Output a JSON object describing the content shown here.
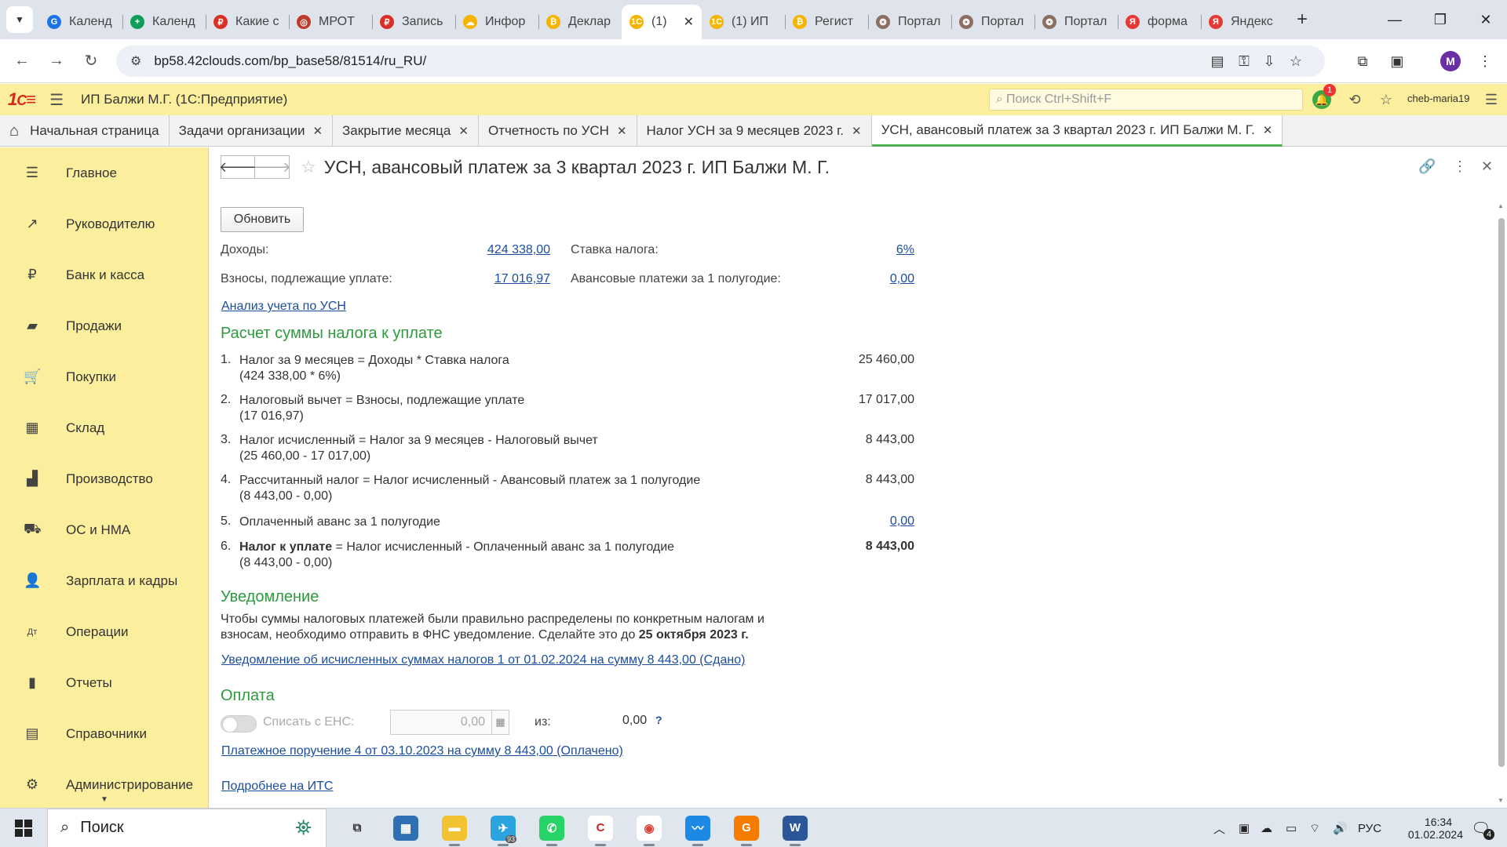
{
  "browser": {
    "tabs": [
      {
        "title": "Календ",
        "color": "#1a73e8",
        "glyph": "G"
      },
      {
        "title": "Календ",
        "color": "#0f9d58",
        "glyph": "+"
      },
      {
        "title": "Какие с",
        "color": "#d93025",
        "glyph": "₽"
      },
      {
        "title": "МРОТ",
        "color": "#c0392b",
        "glyph": "◎"
      },
      {
        "title": "Запись",
        "color": "#d93025",
        "glyph": "₽"
      },
      {
        "title": "Инфор",
        "color": "#f4b400",
        "glyph": "☁"
      },
      {
        "title": "Деклар",
        "color": "#f4b400",
        "glyph": "₿"
      },
      {
        "title": "(1)",
        "color": "#f4b400",
        "glyph": "1С",
        "active": true
      },
      {
        "title": "(1) ИП",
        "color": "#f4b400",
        "glyph": "1С"
      },
      {
        "title": "Регист",
        "color": "#f4b400",
        "glyph": "₿"
      },
      {
        "title": "Портал",
        "color": "#8d6e63",
        "glyph": "❂"
      },
      {
        "title": "Портал",
        "color": "#8d6e63",
        "glyph": "❂"
      },
      {
        "title": "Портал",
        "color": "#8d6e63",
        "glyph": "❂"
      },
      {
        "title": "форма",
        "color": "#e53935",
        "glyph": "Я"
      },
      {
        "title": "Яндекс",
        "color": "#e53935",
        "glyph": "Я"
      }
    ],
    "url": "bp58.42clouds.com/bp_base58/81514/ru_RU/",
    "profile_initial": "M"
  },
  "app": {
    "title": "ИП Балжи М.Г.  (1С:Предприятие)",
    "search_placeholder": "Поиск Ctrl+Shift+F",
    "notification_count": "1",
    "user": "cheb-maria19"
  },
  "section_tabs": [
    {
      "label": "Начальная страница",
      "closable": false
    },
    {
      "label": "Задачи организации",
      "closable": true
    },
    {
      "label": "Закрытие месяца",
      "closable": true
    },
    {
      "label": "Отчетность по УСН",
      "closable": true
    },
    {
      "label": "Налог УСН за 9 месяцев 2023 г.",
      "closable": true
    },
    {
      "label": "УСН, авансовый платеж за 3 квартал 2023 г. ИП Балжи М. Г.",
      "closable": true,
      "active": true
    }
  ],
  "sidebar": [
    {
      "label": "Главное",
      "icon": "menu-icon",
      "glyph": "☰"
    },
    {
      "label": "Руководителю",
      "icon": "trend-icon",
      "glyph": "↗"
    },
    {
      "label": "Банк и касса",
      "icon": "coin-icon",
      "glyph": "₽"
    },
    {
      "label": "Продажи",
      "icon": "bag-icon",
      "glyph": "▰"
    },
    {
      "label": "Покупки",
      "icon": "cart-icon",
      "glyph": "🛒"
    },
    {
      "label": "Склад",
      "icon": "warehouse-icon",
      "glyph": "▦"
    },
    {
      "label": "Производство",
      "icon": "factory-icon",
      "glyph": "▟"
    },
    {
      "label": "ОС и НМА",
      "icon": "truck-icon",
      "glyph": "⛟"
    },
    {
      "label": "Зарплата и кадры",
      "icon": "person-icon",
      "glyph": "👤"
    },
    {
      "label": "Операции",
      "icon": "dt-kt-icon",
      "glyph": "Дт"
    },
    {
      "label": "Отчеты",
      "icon": "bar-chart-icon",
      "glyph": "▮"
    },
    {
      "label": "Справочники",
      "icon": "book-icon",
      "glyph": "▤"
    },
    {
      "label": "Администрирование",
      "icon": "gear-icon",
      "glyph": "⚙"
    }
  ],
  "doc": {
    "title": "УСН, авансовый платеж за 3 квартал 2023 г. ИП Балжи М. Г.",
    "refresh_label": "Обновить",
    "income_label": "Доходы:",
    "income_value": "424 338,00",
    "tax_rate_label": "Ставка налога:",
    "tax_rate_value": "6%",
    "contrib_label": "Взносы, подлежащие уплате:",
    "contrib_value": "17 016,97",
    "advance_label": "Авансовые платежи за 1 полугодие:",
    "advance_value": "0,00",
    "analysis_link": "Анализ учета по УСН",
    "calc_heading": "Расчет суммы налога к уплате",
    "calc_rows": [
      {
        "num": "1.",
        "line1": "Налог за 9 месяцев = Доходы * Ставка налога",
        "line2": "(424 338,00 * 6%)",
        "value": "25 460,00"
      },
      {
        "num": "2.",
        "line1": "Налоговый вычет = Взносы, подлежащие уплате",
        "line2": "(17 016,97)",
        "value": "17 017,00"
      },
      {
        "num": "3.",
        "line1": "Налог исчисленный = Налог за 9 месяцев - Налоговый вычет",
        "line2": "(25 460,00 - 17 017,00)",
        "value": "8 443,00"
      },
      {
        "num": "4.",
        "line1": "Рассчитанный налог = Налог исчисленный - Авансовый платеж за 1 полугодие",
        "line2": "(8 443,00 - 0,00)",
        "value": "8 443,00"
      },
      {
        "num": "5.",
        "line1": "Оплаченный аванс за 1 полугодие",
        "line2": "",
        "value": "0,00"
      },
      {
        "num": "6.",
        "line1_bold": "Налог к уплате",
        "line1": " = Налог исчисленный - Оплаченный аванс за 1 полугодие",
        "line2": "(8 443,00 - 0,00)",
        "value": "8 443,00"
      }
    ],
    "notice_heading": "Уведомление",
    "notice_text1": "Чтобы суммы налоговых платежей были правильно распределены по конкретным налогам и",
    "notice_text2": "взносам, необходимо отправить в ФНС уведомление. Сделайте это до ",
    "notice_deadline": "25 октября 2023 г.",
    "notice_link": "Уведомление об исчисленных суммах налогов 1 от 01.02.2024 на сумму 8 443,00 (Сдано)",
    "payment_heading": "Оплата",
    "ens_label": "Списать с ЕНС:",
    "ens_value": "0,00",
    "of_label": "из:",
    "of_value": "0,00",
    "help_glyph": "?",
    "payment_link": "Платежное поручение 4 от 03.10.2023 на сумму 8 443,00 (Оплачено)",
    "its_link": "Подробнее на ИТС"
  },
  "taskbar": {
    "search": "Поиск",
    "apps": [
      {
        "name": "task-view",
        "color": "#dfe6ee",
        "glyph": "⧉",
        "fg": "#333"
      },
      {
        "name": "calculator",
        "color": "#2f6fb3",
        "glyph": "▦",
        "fg": "#fff"
      },
      {
        "name": "explorer",
        "color": "#f2c230",
        "glyph": "▬",
        "fg": "#fff"
      },
      {
        "name": "telegram",
        "color": "#2aa3df",
        "glyph": "✈",
        "fg": "#fff",
        "badge": "93"
      },
      {
        "name": "whatsapp",
        "color": "#25d366",
        "glyph": "✆",
        "fg": "#fff"
      },
      {
        "name": "app-c",
        "color": "#ffffff",
        "glyph": "C",
        "fg": "#c22"
      },
      {
        "name": "chrome",
        "color": "#ffffff",
        "glyph": "◉",
        "fg": "#db4437"
      },
      {
        "name": "app-wave",
        "color": "#1e88e5",
        "glyph": "〰",
        "fg": "#fff"
      },
      {
        "name": "pdf-app",
        "color": "#f57c00",
        "glyph": "G",
        "fg": "#fff"
      },
      {
        "name": "word",
        "color": "#2b579a",
        "glyph": "W",
        "fg": "#fff"
      }
    ],
    "lang": "РУС",
    "time": "16:34",
    "date": "01.02.2024",
    "notif_count": "4"
  }
}
